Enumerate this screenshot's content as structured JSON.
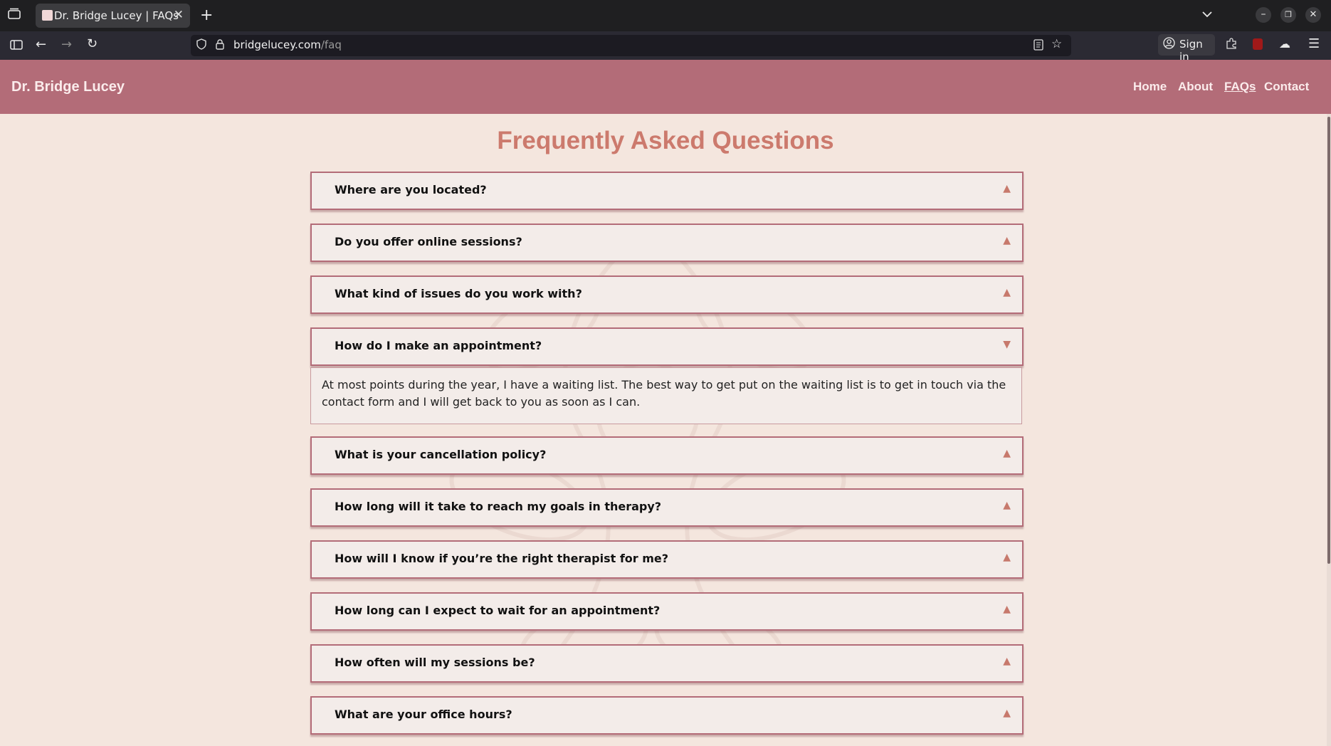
{
  "browser": {
    "tab_title": "Dr. Bridge Lucey | FAQs",
    "url_host": "bridgelucey.com",
    "url_path": "/faq",
    "signin_label": "Sign in"
  },
  "site": {
    "brand": "Dr. Bridge Lucey",
    "nav": [
      "Home",
      "About",
      "FAQs",
      "Contact"
    ],
    "active_nav": "FAQs"
  },
  "page": {
    "title": "Frequently Asked Questions",
    "faqs": [
      {
        "question": "Where are you located?",
        "expanded": false
      },
      {
        "question": "Do you offer online sessions?",
        "expanded": false
      },
      {
        "question": "What kind of issues do you work with?",
        "expanded": false
      },
      {
        "question": "How do I make an appointment?",
        "expanded": true,
        "answer": "At most points during the year, I have a waiting list. The best way to get put on the waiting list is to get in touch via the contact form and I will get back to you as soon as I can."
      },
      {
        "question": "What is your cancellation policy?",
        "expanded": false
      },
      {
        "question": "How long will it take to reach my goals in therapy?",
        "expanded": false
      },
      {
        "question": "How will I know if you’re the right therapist for me?",
        "expanded": false
      },
      {
        "question": "How long can I expect to wait for an appointment?",
        "expanded": false
      },
      {
        "question": "How often will my sessions be?",
        "expanded": false
      },
      {
        "question": "What are your office hours?",
        "expanded": false
      }
    ]
  },
  "colors": {
    "header_bg": "#b36c78",
    "page_bg": "#f4e6de",
    "title_color": "#cc7a6d",
    "accent_border": "#b36c78"
  }
}
